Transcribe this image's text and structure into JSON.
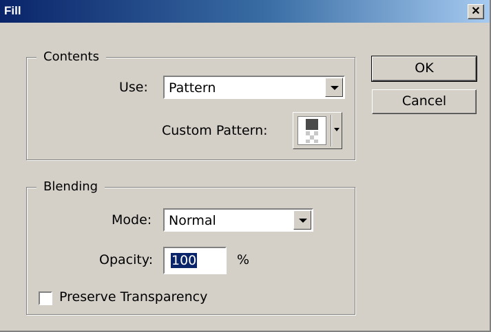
{
  "window": {
    "title": "Fill",
    "close_glyph": "✕"
  },
  "contents": {
    "legend": "Contents",
    "use_label": "Use:",
    "use_value": "Pattern",
    "custom_pattern_label": "Custom Pattern:"
  },
  "blending": {
    "legend": "Blending",
    "mode_label": "Mode:",
    "mode_value": "Normal",
    "opacity_label": "Opacity:",
    "opacity_value": "100",
    "opacity_unit": "%",
    "preserve_transparency_label": "Preserve Transparency",
    "preserve_transparency_checked": false
  },
  "buttons": {
    "ok": "OK",
    "cancel": "Cancel"
  },
  "icons": {
    "close": "close-icon",
    "dropdown": "chevron-down-icon",
    "pattern": "pattern-swatch-icon"
  },
  "colors": {
    "dialog_bg": "#d4d0c8",
    "title_start": "#0a246a",
    "title_end": "#a6caf0",
    "selection": "#0a246a"
  }
}
